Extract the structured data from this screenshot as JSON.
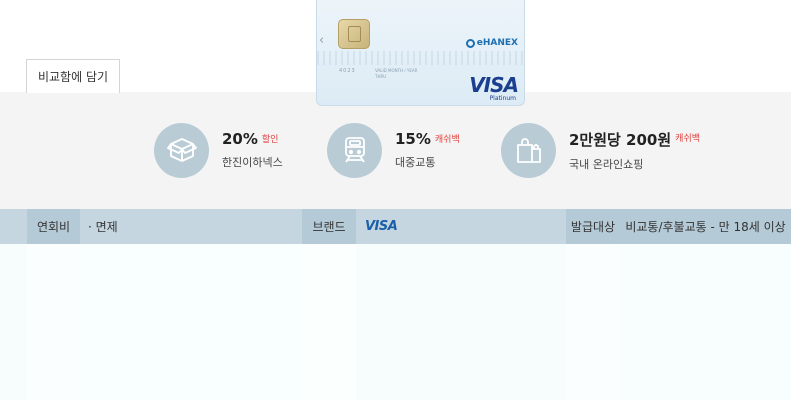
{
  "compare_button": {
    "label": "비교함에 담기"
  },
  "card_image": {
    "issuer_logo": "eHANEX",
    "network": "VISA",
    "tier": "Platinum",
    "number_fragment": "4023",
    "small_text_1": "VALID",
    "small_text_2": "THRU",
    "small_text_3": "MONTH / YEAR",
    "nav_icon": "chevron-left-icon"
  },
  "benefits": [
    {
      "icon": "box-icon",
      "value": "20%",
      "tag": "할인",
      "desc": "한진이하넥스"
    },
    {
      "icon": "train-icon",
      "value": "15%",
      "tag": "캐쉬백",
      "desc": "대중교통"
    },
    {
      "icon": "shopping-bag-icon",
      "value": "2만원당 200원",
      "tag": "캐쉬백",
      "desc": "국내 온라인쇼핑"
    }
  ],
  "specs": {
    "annual_fee_label": "연회비",
    "annual_fee_value": "· 면제",
    "brand_label": "브랜드",
    "brand_value": "VISA",
    "target_label": "발급대상",
    "target_value": "비교통/후불교통 - 만 18세 이상"
  },
  "colors": {
    "accent_tag": "#e0403c",
    "icon_circle": "#b9ccd6",
    "spec_row": "#c5d6e0",
    "visa_blue": "#1a5fa8"
  }
}
